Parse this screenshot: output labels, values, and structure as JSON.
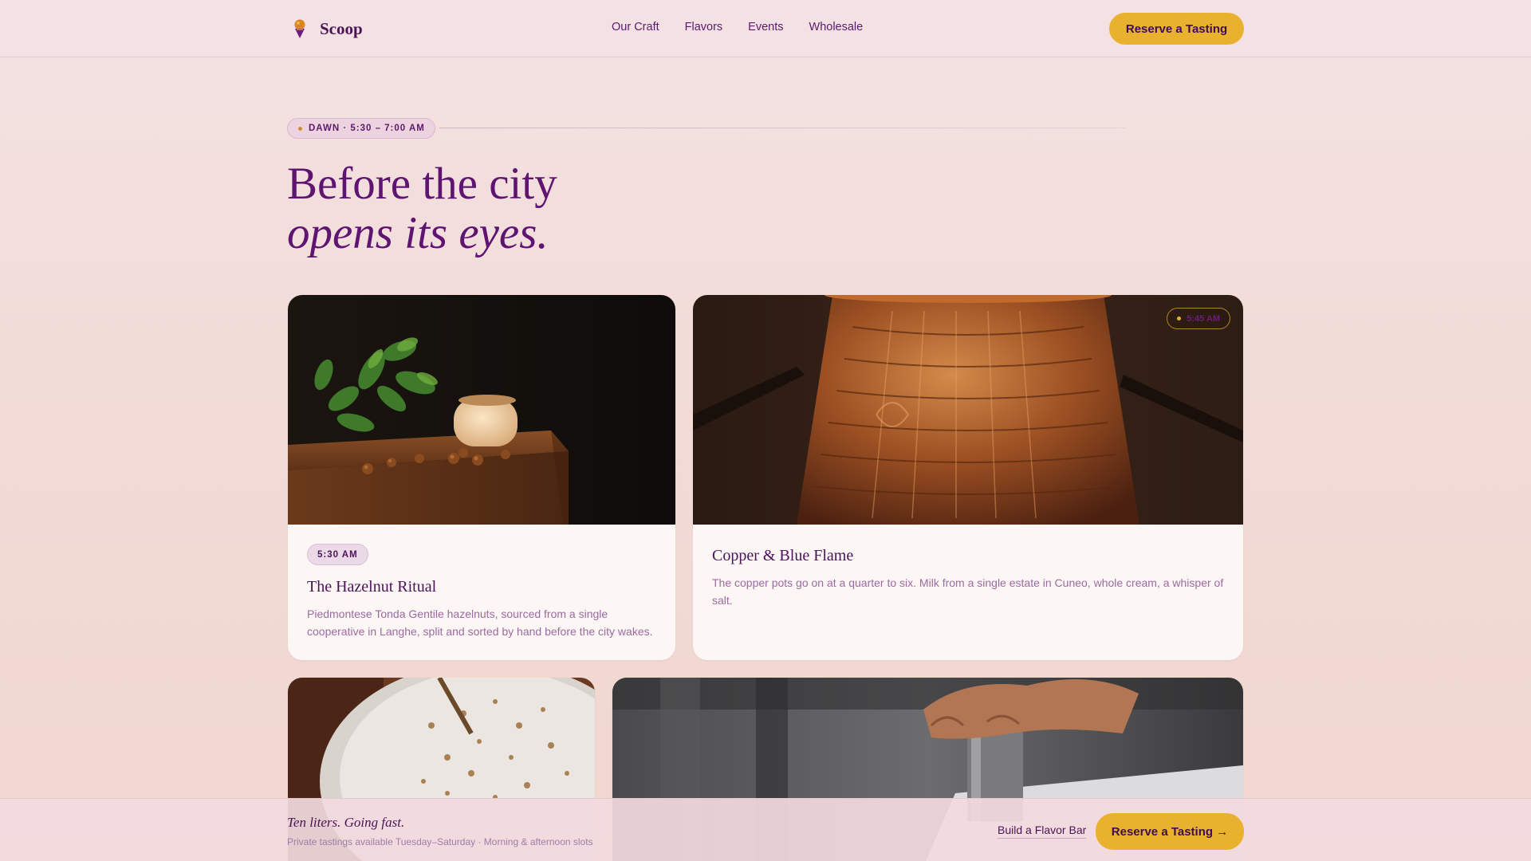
{
  "nav": {
    "brand": "Scoop",
    "links": [
      "Our Craft",
      "Flavors",
      "Events",
      "Wholesale"
    ],
    "cta": "Reserve a Tasting"
  },
  "hero": {
    "eyebrow": "DAWN · 5:30 – 7:00 AM",
    "title_line1": "Before the city",
    "title_line2": "opens its eyes."
  },
  "cards": [
    {
      "time": "5:30 AM",
      "title": "The Hazelnut Ritual",
      "description": "Piedmontese Tonda Gentile hazelnuts, sourced from a single cooperative in Langhe, split and sorted by hand before the city wakes."
    },
    {
      "badge": "5:45 AM",
      "title": "Copper & Blue Flame",
      "description": "The copper pots go on at a quarter to six. Milk from a single estate in Cuneo, whole cream, a whisper of salt."
    }
  ],
  "bottom_bar": {
    "title": "Ten liters. Going fast.",
    "subtitle": "Private tastings available Tuesday–Saturday · Morning & afternoon slots",
    "link": "Build a Flavor Bar",
    "cta": "Reserve a Tasting →"
  },
  "colors": {
    "accent_gold": "#e8b22e",
    "brand_purple": "#5e1470",
    "background": "#f2dcd8"
  },
  "icons": [
    "ice-cream-icon",
    "dot-icon"
  ]
}
